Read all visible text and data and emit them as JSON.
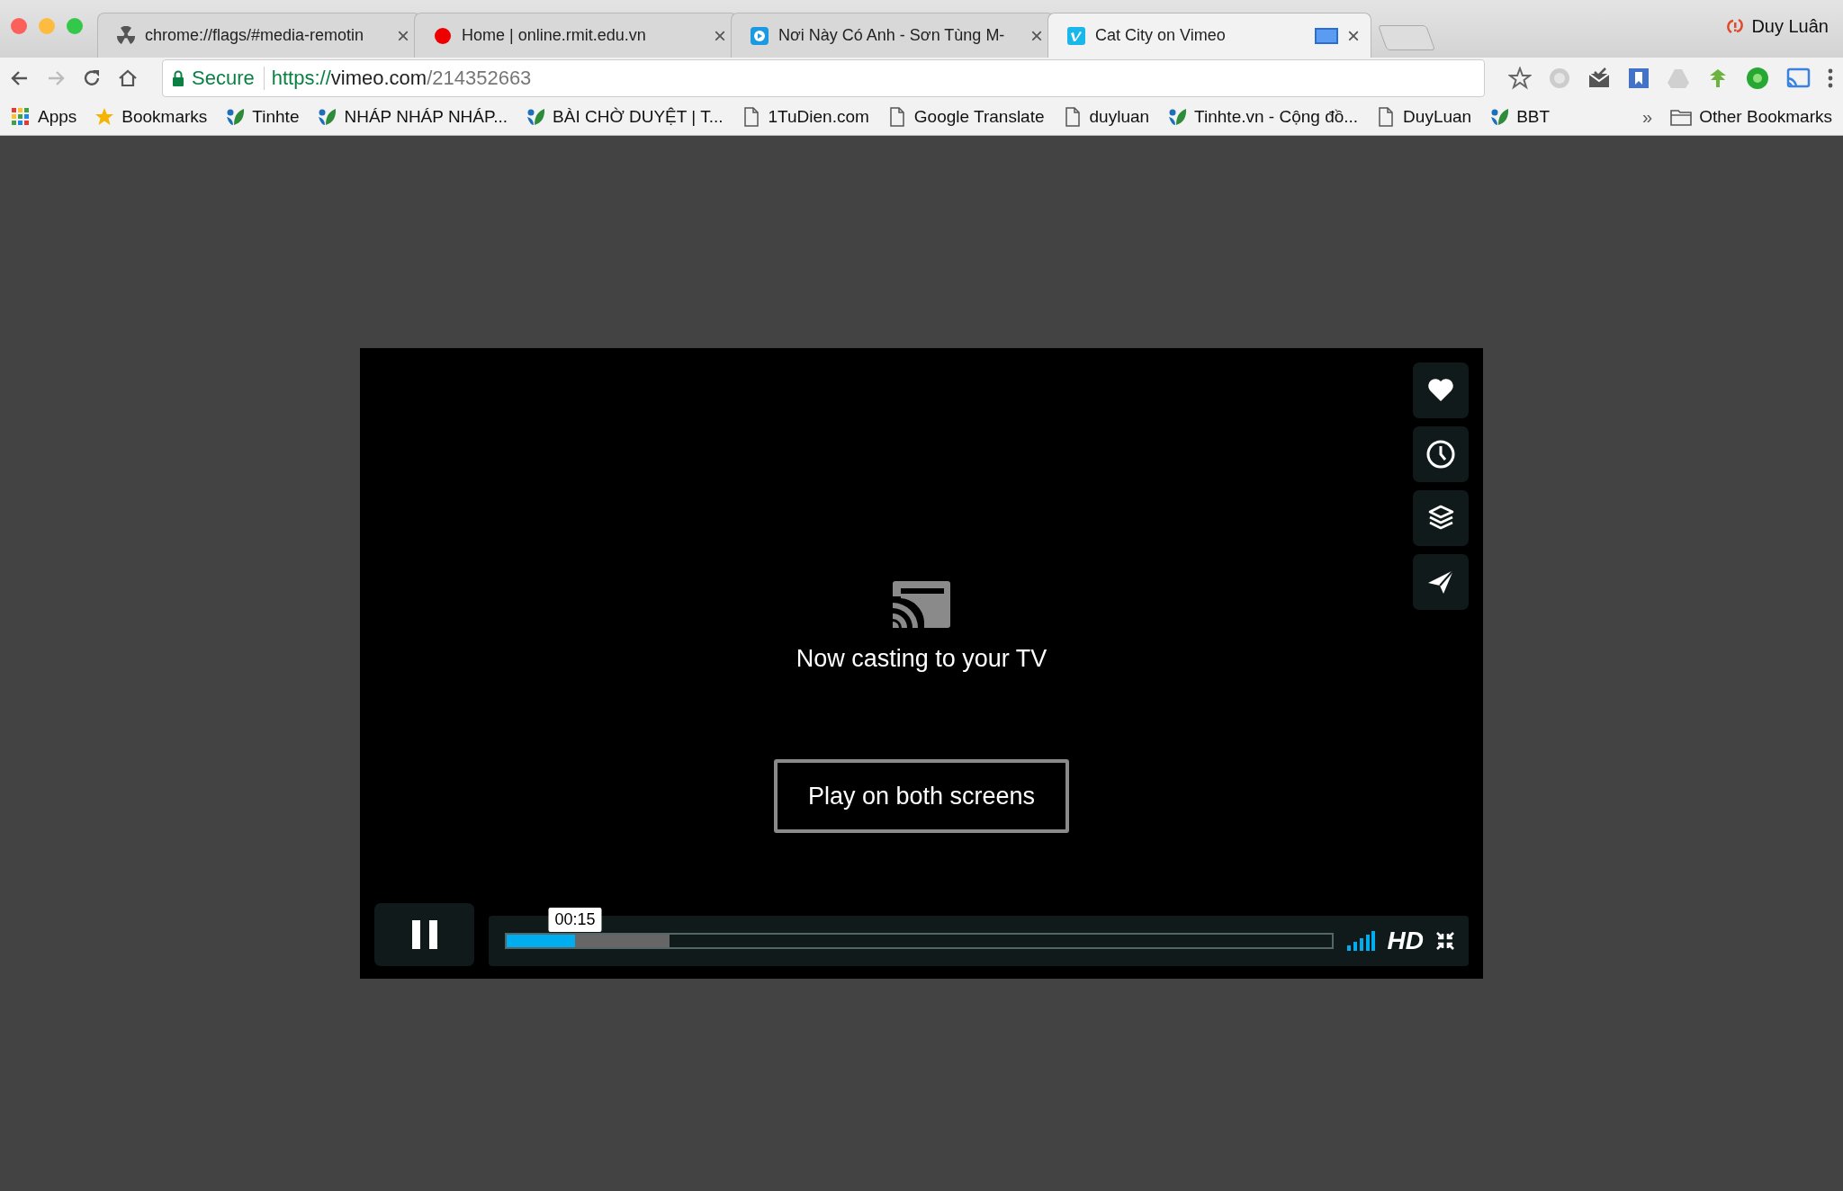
{
  "browser": {
    "tabs": [
      {
        "title": "chrome://flags/#media-remotin",
        "kind": "radiation",
        "selected": false,
        "casting": false,
        "close": "×"
      },
      {
        "title": "Home | online.rmit.edu.vn",
        "kind": "circle",
        "selected": false,
        "casting": false,
        "close": "×"
      },
      {
        "title": "Nơi Này Có Anh - Sơn Tùng M-",
        "kind": "app",
        "selected": false,
        "casting": false,
        "close": "×"
      },
      {
        "title": "Cat City on Vimeo",
        "kind": "vimeo",
        "selected": true,
        "casting": true,
        "close": "×"
      }
    ],
    "profile": "Duy Luân",
    "address": {
      "security": "Secure",
      "scheme": "https://",
      "host": "vimeo.com",
      "path": "/214352663"
    },
    "bookmarks": [
      {
        "label": "Apps",
        "kind": "apps"
      },
      {
        "label": "Bookmarks",
        "kind": "star"
      },
      {
        "label": "Tinhte",
        "kind": "site"
      },
      {
        "label": "NHÁP NHÁP NHÁP...",
        "kind": "site"
      },
      {
        "label": "BÀI CHỜ DUYỆT | T...",
        "kind": "site"
      },
      {
        "label": "1TuDien.com",
        "kind": "page"
      },
      {
        "label": "Google Translate",
        "kind": "page"
      },
      {
        "label": "duyluan",
        "kind": "page"
      },
      {
        "label": "Tinhte.vn - Cộng đồ...",
        "kind": "site"
      },
      {
        "label": "DuyLuan",
        "kind": "page"
      },
      {
        "label": "BBT",
        "kind": "site"
      }
    ],
    "bookmarks_overflow": "»",
    "other_bookmarks": "Other Bookmarks"
  },
  "player": {
    "message": "Now casting to your TV",
    "button": "Play on both screens",
    "actions": [
      {
        "kind": "like"
      },
      {
        "kind": "watch_later"
      },
      {
        "kind": "collections"
      },
      {
        "kind": "share"
      }
    ],
    "playing": true,
    "time": "00:15",
    "progress": {
      "level": 0.083
    },
    "buffered": {
      "level": 0.198
    },
    "quality": "HD"
  }
}
